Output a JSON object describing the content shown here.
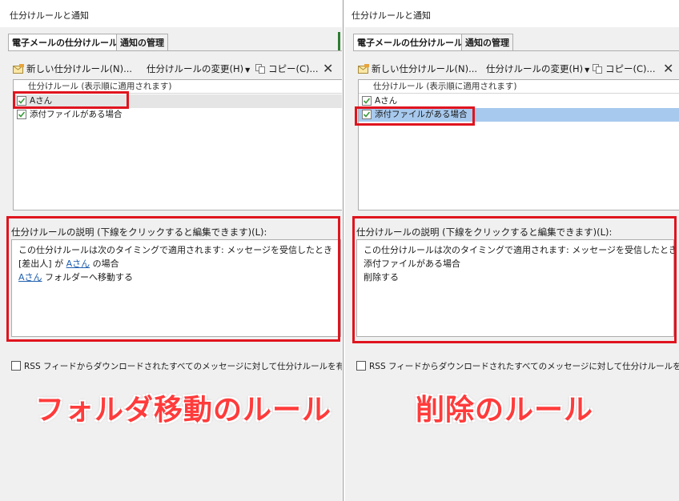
{
  "left": {
    "window_title": "仕分けルールと通知",
    "tabs": [
      {
        "label": "電子メールの仕分けルール",
        "active": true
      },
      {
        "label": "通知の管理",
        "active": false
      }
    ],
    "toolbar": {
      "new_rule": "新しい仕分けルール(N)...",
      "change_rule": "仕分けルールの変更(H)",
      "copy": "コピー(C)...",
      "delete_glyph": "✕"
    },
    "list": {
      "header": "仕分けルール (表示順に適用されます)",
      "rows": [
        "Aさん",
        "添付ファイルがある場合"
      ],
      "highlighted_row": 0
    },
    "description": {
      "label": "仕分けルールの説明 (下線をクリックすると編集できます)(L):",
      "line1": "この仕分けルールは次のタイミングで適用されます: メッセージを受信したとき",
      "line2_pre": "[差出人] が ",
      "line2_link": "Aさん",
      "line2_post": " の場合",
      "line3_link": "Aさん",
      "line3_post": " フォルダーへ移動する"
    },
    "rss_checkbox": "RSS フィードからダウンロードされたすべてのメッセージに対して仕分けルールを有効にする",
    "caption": "フォルダ移動のルール"
  },
  "right": {
    "window_title": "仕分けルールと通知",
    "tabs": [
      {
        "label": "電子メールの仕分けルール",
        "active": true
      },
      {
        "label": "通知の管理",
        "active": false
      }
    ],
    "toolbar": {
      "new_rule": "新しい仕分けルール(N)...",
      "change_rule": "仕分けルールの変更(H)",
      "copy": "コピー(C)...",
      "delete_glyph": "✕"
    },
    "list": {
      "header": "仕分けルール (表示順に適用されます)",
      "rows": [
        "Aさん",
        "添付ファイルがある場合"
      ],
      "selected_row": 1
    },
    "description": {
      "label": "仕分けルールの説明 (下線をクリックすると編集できます)(L):",
      "line1": "この仕分けルールは次のタイミングで適用されます: メッセージを受信したとき",
      "line2": "添付ファイルがある場合",
      "line3": "削除する"
    },
    "rss_checkbox": "RSS フィードからダウンロードされたすべてのメッセージに対して仕分けルールを有効にする",
    "caption": "削除のルール"
  },
  "colors": {
    "accent_red": "#e0141e",
    "caption_red": "#ff3b3b",
    "selection_blue": "#a7c9ee",
    "link_blue": "#1f5fae",
    "checkmark_green": "#3d9a3d"
  },
  "icons": {
    "new_rule": "new-rule-icon",
    "copy": "copy-icon",
    "delete": "delete-icon",
    "checkbox": "check-icon"
  }
}
